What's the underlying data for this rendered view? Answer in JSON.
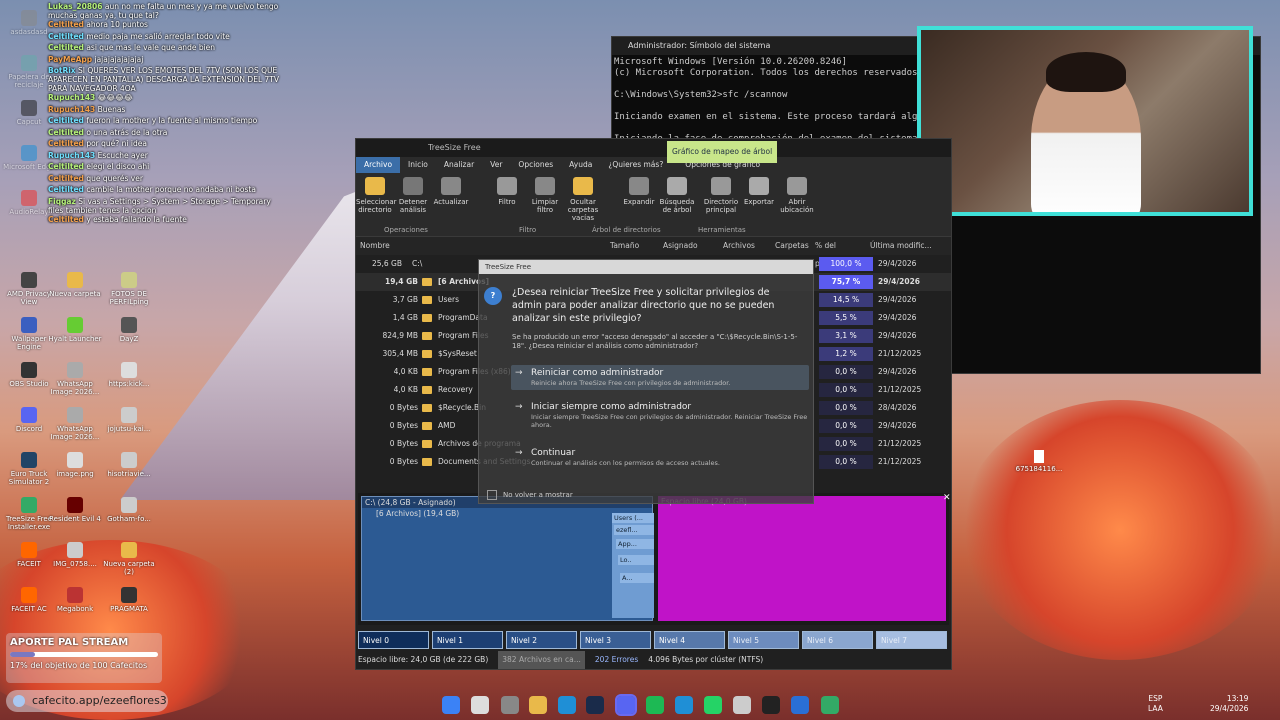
{
  "chat": [
    {
      "user": "Lukas_20806",
      "text": "aun no me falta un mes y ya me vuelvo tengo muchas ganas ya, tu que tal?"
    },
    {
      "user": "Celtilted",
      "text": "ahora 10 puntos"
    },
    {
      "user": "Celtilted",
      "text": "medio paja me salió arreglar todo vite"
    },
    {
      "user": "Celtilted",
      "text": "asi que mas le vale que ande bien"
    },
    {
      "user": "PayMeApp",
      "text": "jajajajajajajaj"
    },
    {
      "user": "BotRix",
      "text": "SI QUERES VER LOS EMOTES DEL 7TV (SON LOS QUE APARECEN EN PANTALLA) DESCARGA LA EXTENSION DEL 7TV PARA NAVEGADOR 4OA"
    },
    {
      "user": "Rupuch143",
      "text": "😂😂😂😂"
    },
    {
      "user": "Rupuch143",
      "text": "Buenas"
    },
    {
      "user": "Celtilted",
      "text": "fueron la mother y la fuente al mismo tiempo"
    },
    {
      "user": "Celtilted",
      "text": "o una atrás de la otra"
    },
    {
      "user": "Celtilted",
      "text": "por qué? ni idea"
    },
    {
      "user": "Rupuch143",
      "text": "Escuche ayer"
    },
    {
      "user": "Celtilted",
      "text": "elegi el disco ahi"
    },
    {
      "user": "Celtilted",
      "text": "que querés ver"
    },
    {
      "user": "Celtilted",
      "text": "cambie la mother porque no andaba ni bosta"
    },
    {
      "user": "Fiqgaz",
      "text": "Si vas a Settings > System > Storage > Temporary files tambien tenes la opcion"
    },
    {
      "user": "Celtilted",
      "text": "y estaba fallando la fuente"
    }
  ],
  "desktop_icons": [
    {
      "label": "asdasdasd",
      "color": "#888"
    },
    {
      "label": "Papelera de reciclaje",
      "color": "#6aa"
    },
    {
      "label": "Capcut",
      "color": "#222"
    },
    {
      "label": "Microsoft Edge",
      "color": "#1f8fd6"
    },
    {
      "label": "AudioRelay",
      "color": "#e33"
    },
    {
      "label": "AMD Privacy View",
      "color": "#444"
    },
    {
      "label": "Nueva carpeta",
      "color": "#e9b94a"
    },
    {
      "label": "FOTOS DE PERFILping",
      "color": "#cc8"
    },
    {
      "label": "Wallpaper Engine",
      "color": "#3b5fc0"
    },
    {
      "label": "Hyalt Launcher",
      "color": "#6c3"
    },
    {
      "label": "DayZ",
      "color": "#555"
    },
    {
      "label": "OBS Studio",
      "color": "#333"
    },
    {
      "label": "WhatsApp Image 2026...",
      "color": "#aaa"
    },
    {
      "label": "https:kick...",
      "color": "#ddd"
    },
    {
      "label": "Discord",
      "color": "#5865f2"
    },
    {
      "label": "WhatsApp Image 2026...",
      "color": "#aaa"
    },
    {
      "label": "jojutsu-kai...",
      "color": "#ccc"
    },
    {
      "label": "Euro Truck Simulator 2",
      "color": "#246"
    },
    {
      "label": "image.png",
      "color": "#ddd"
    },
    {
      "label": "hisotriavie...",
      "color": "#ccc"
    },
    {
      "label": "TreeSize Free Installer.exe",
      "color": "#3a6"
    },
    {
      "label": "Resident Evil 4",
      "color": "#600"
    },
    {
      "label": "Gotham-fo...",
      "color": "#ccc"
    },
    {
      "label": "FACEIT",
      "color": "#f60"
    },
    {
      "label": "IMG_0758....",
      "color": "#ccc"
    },
    {
      "label": "Nueva carpeta (2)",
      "color": "#e9b94a"
    },
    {
      "label": "FACEIT AC",
      "color": "#f60"
    },
    {
      "label": "Megabonk",
      "color": "#b33"
    },
    {
      "label": "PRAGMATA",
      "color": "#333"
    }
  ],
  "desktop_file": "675184116...",
  "cmd": {
    "title": "Administrador: Símbolo del sistema",
    "lines": [
      "Microsoft Windows [Versión 10.0.26200.8246]",
      "(c) Microsoft Corporation. Todos los derechos reservados.",
      "",
      "C:\\Windows\\System32>sfc /scannow",
      "",
      "Iniciando examen en el sistema. Este proceso tardará algú",
      "",
      "Iniciando la fase de comprobación del examen del sistema."
    ]
  },
  "treesize": {
    "title": "TreeSize Free",
    "context_tab": "Gráfico de mapeo de árbol",
    "menu": [
      "Archivo",
      "Inicio",
      "Analizar",
      "Ver",
      "Opciones",
      "Ayuda",
      "¿Quieres más?",
      "Opciones de gráfico"
    ],
    "ribbon": [
      "Seleccionar directorio",
      "Detener análisis",
      "Actualizar",
      "Filtro",
      "Limpiar filtro",
      "Ocultar carpetas vacías",
      "Expandir",
      "Búsqueda de árbol",
      "Directorio principal",
      "Exportar",
      "Abrir ubicación"
    ],
    "groups": [
      "Operaciones",
      "Filtro",
      "Árbol de directorios",
      "Herramientas"
    ],
    "columns": [
      "Nombre",
      "Tamaño",
      "Asignado",
      "Archivos",
      "Carpetas",
      "% del princi...",
      "Última modific..."
    ],
    "root": {
      "size": "25,6 GB",
      "name": "C:\\",
      "pct": "100,0 %",
      "date": "29/4/2026"
    },
    "rows": [
      {
        "size": "19,4 GB",
        "name": "[6 Archivos]",
        "pct": "75,7 %",
        "date": "29/4/2026"
      },
      {
        "size": "3,7 GB",
        "name": "Users",
        "pct": "14,5 %",
        "date": "29/4/2026"
      },
      {
        "size": "1,4 GB",
        "name": "ProgramData",
        "pct": "5,5 %",
        "date": "29/4/2026"
      },
      {
        "size": "824,9 MB",
        "name": "Program Files",
        "pct": "3,1 %",
        "date": "29/4/2026"
      },
      {
        "size": "305,4 MB",
        "name": "$SysReset",
        "pct": "1,2 %",
        "date": "21/12/2025"
      },
      {
        "size": "4,0 KB",
        "name": "Program Files (x86)",
        "pct": "0,0 %",
        "date": "29/4/2026"
      },
      {
        "size": "4,0 KB",
        "name": "Recovery",
        "pct": "0,0 %",
        "date": "21/12/2025"
      },
      {
        "size": "0 Bytes",
        "name": "$Recycle.Bin",
        "pct": "0,0 %",
        "date": "28/4/2026"
      },
      {
        "size": "0 Bytes",
        "name": "AMD",
        "pct": "0,0 %",
        "date": "29/4/2026"
      },
      {
        "size": "0 Bytes",
        "name": "Archivos de programa",
        "pct": "0,0 %",
        "date": "21/12/2025"
      },
      {
        "size": "0 Bytes",
        "name": "Documents and Settings",
        "pct": "0,0 %",
        "date": "21/12/2025"
      }
    ],
    "treemap": {
      "header": "C:\\ (24,8 GB - Asignado)",
      "files": "[6 Archivos] (19,4 GB)",
      "free": "Espacio libre (24,0 GB)",
      "small": [
        "Users (...",
        "ezefl...",
        "App...",
        "Lo..",
        "A..."
      ]
    },
    "levels": [
      "Nivel 0",
      "Nivel 1",
      "Nivel 2",
      "Nivel 3",
      "Nivel 4",
      "Nivel 5",
      "Nivel 6",
      "Nivel 7"
    ],
    "status": [
      "Espacio libre: 24,0 GB (de 222 GB)",
      "382 Archivos en ca...",
      "202 Errores",
      "4.096 Bytes por clúster (NTFS)"
    ]
  },
  "dialog": {
    "title": "TreeSize Free",
    "question": "¿Desea reiniciar TreeSize Free y solicitar privilegios de admin para poder analizar directorio que no se pueden analizar sin este privilegio?",
    "detail": "Se ha producido un error \"acceso denegado\" al acceder a \"C:\\$Recycle.Bin\\S-1-5-18\". ¿Desea reiniciar el análisis como administrador?",
    "options": [
      {
        "title": "Reiniciar como administrador",
        "desc": "Reinicie ahora TreeSize Free con privilegios de administrador."
      },
      {
        "title": "Iniciar siempre como administrador",
        "desc": "Iniciar siempre TreeSize Free con privilegios de administrador. Reiniciar TreeSize Free ahora."
      },
      {
        "title": "Continuar",
        "desc": "Continuar el análisis con los permisos de acceso actuales."
      }
    ],
    "checkbox": "No volver a mostrar"
  },
  "donation": {
    "title": "APORTE PAL STREAM",
    "progress": 0.17,
    "subtitle": "17% del objetivo de 100 Cafecitos"
  },
  "link_pill": "cafecito.app/ezeeflores3",
  "taskbar": {
    "lang": "ESP",
    "lang2": "LAA",
    "time": "13:19",
    "date": "29/4/2026"
  }
}
